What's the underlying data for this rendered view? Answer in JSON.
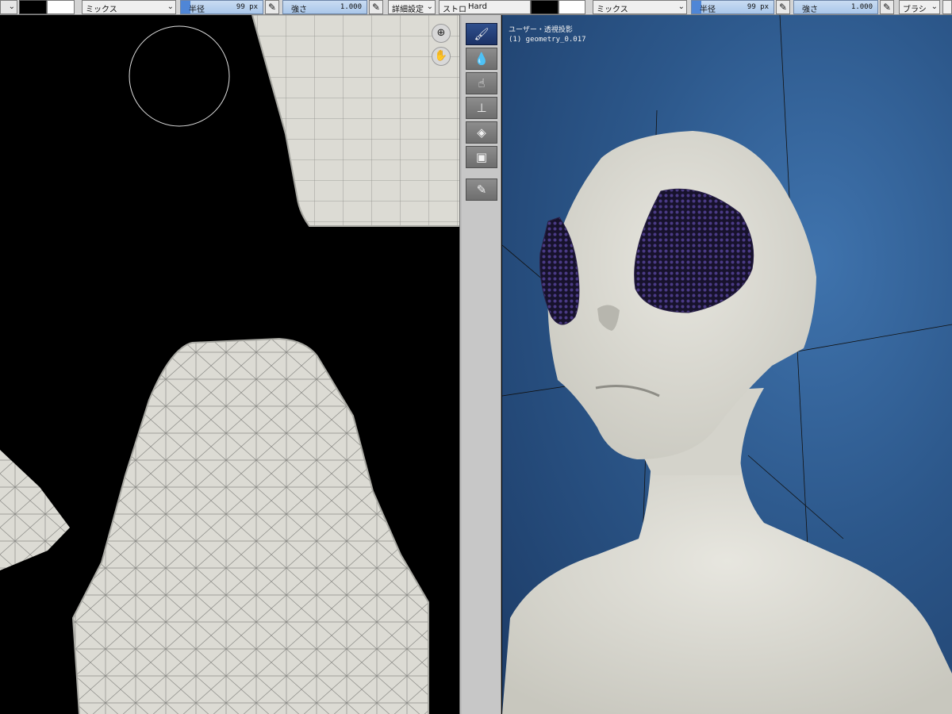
{
  "toolbar": {
    "left": {
      "blend_mode": "ミックス",
      "radius_label": "半径",
      "radius_value": "99 px",
      "strength_label": "強さ",
      "strength_value": "1.000",
      "advanced_label": "詳細設定",
      "stroke_label": "ストローク",
      "stroke_value": "Hard"
    },
    "right": {
      "blend_mode": "ミックス",
      "radius_label": "半径",
      "radius_value": "99 px",
      "strength_label": "強さ",
      "strength_value": "1.000",
      "brush_label": "ブラシ"
    }
  },
  "viewport": {
    "view_name": "ユーザー・透視投影",
    "object_name": "(1) geometry_0.017"
  },
  "tools": [
    {
      "name": "draw",
      "icon": "brush-icon",
      "active": true
    },
    {
      "name": "soften",
      "icon": "drop-icon",
      "active": false
    },
    {
      "name": "smear",
      "icon": "finger-icon",
      "active": false
    },
    {
      "name": "clone",
      "icon": "stamp-icon",
      "active": false
    },
    {
      "name": "fill",
      "icon": "bucket-icon",
      "active": false
    },
    {
      "name": "mask",
      "icon": "mask-icon",
      "active": false
    },
    {
      "name": "annotate",
      "icon": "pencil-icon",
      "active": false
    }
  ],
  "colors": {
    "viewport_bg": "#2c578a",
    "active_tool": "#1c3266",
    "mesh": "#dcdbd4",
    "eye": "#2a2148"
  }
}
